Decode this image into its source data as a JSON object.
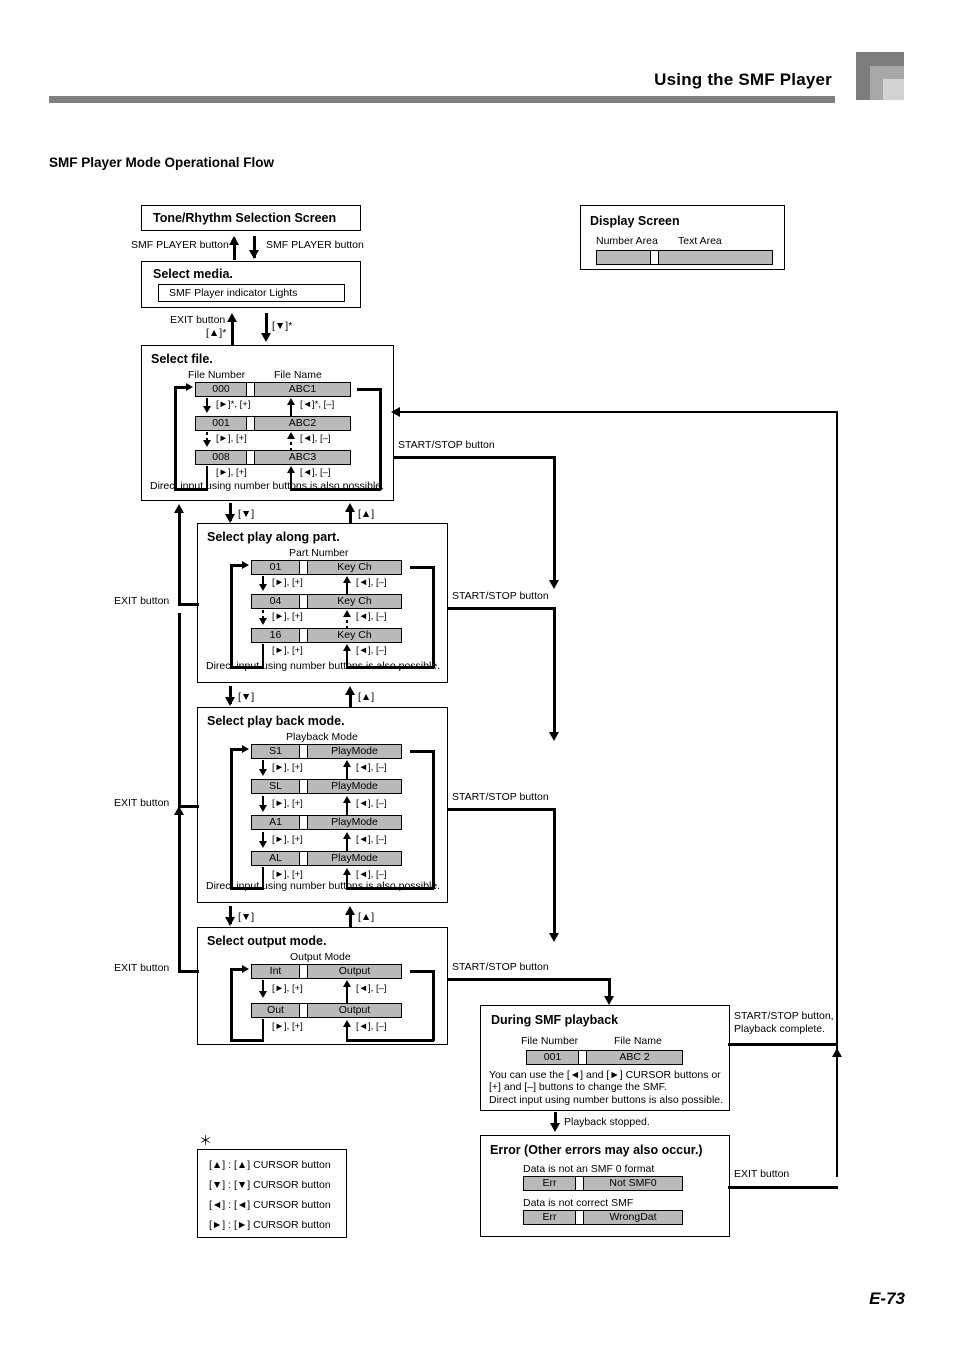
{
  "header": {
    "title": "Using the SMF Player",
    "section_title": "SMF Player Mode Operational Flow",
    "page_number": "E-73"
  },
  "display_screen": {
    "title": "Display Screen",
    "number_area_label": "Number Area",
    "text_area_label": "Text Area"
  },
  "nodes": {
    "tone_rhythm": {
      "title": "Tone/Rhythm Selection Screen"
    },
    "select_media": {
      "title": "Select media.",
      "indicator": "SMF Player indicator Lights"
    },
    "select_file": {
      "title": "Select file.",
      "col1_label": "File Number",
      "col2_label": "File Name",
      "note": "Direct input using number buttons is also possible.",
      "rows": [
        {
          "num": "000",
          "name": "ABC1"
        },
        {
          "num": "001",
          "name": "ABC2"
        },
        {
          "num": "008",
          "name": "ABC3"
        }
      ]
    },
    "select_part": {
      "title": "Select play along part.",
      "col_label": "Part Number",
      "note": "Direct input using number buttons is also possible.",
      "rows": [
        {
          "num": "01",
          "name": "Key  Ch"
        },
        {
          "num": "04",
          "name": "Key  Ch"
        },
        {
          "num": "16",
          "name": "Key  Ch"
        }
      ]
    },
    "select_playback": {
      "title": "Select play back mode.",
      "col_label": "Playback Mode",
      "note": "Direct input using number buttons is also possible.",
      "rows": [
        {
          "num": "S1",
          "name": "PlayMode"
        },
        {
          "num": "SL",
          "name": "PlayMode"
        },
        {
          "num": "A1",
          "name": "PlayMode"
        },
        {
          "num": "AL",
          "name": "PlayMode"
        }
      ]
    },
    "select_output": {
      "title": "Select output mode.",
      "col_label": "Output Mode",
      "rows": [
        {
          "num": "Int",
          "name": "Output"
        },
        {
          "num": "Out",
          "name": "Output"
        }
      ]
    },
    "during_playback": {
      "title": "During SMF playback",
      "col1_label": "File Number",
      "col2_label": "File Name",
      "row": {
        "num": "001",
        "name": "ABC 2"
      },
      "note1": "You can use the [◄] and [►] CURSOR buttons or",
      "note2": "[+] and [–] buttons to change the SMF.",
      "note3": "Direct input using number buttons is also possible."
    },
    "error": {
      "title": "Error (Other errors may also occur.)",
      "case1_label": "Data is not an SMF 0 format",
      "case1": {
        "num": "Err",
        "name": "Not  SMF0"
      },
      "case2_label": "Data is not correct SMF",
      "case2": {
        "num": "Err",
        "name": "WrongDat"
      }
    }
  },
  "transitions": {
    "smf_player_button_up": "SMF PLAYER button",
    "smf_player_button_down": "SMF PLAYER button",
    "exit_button": "EXIT button",
    "exit_button_2": "EXIT button",
    "exit_button_3": "EXIT button",
    "exit_button_4": "EXIT button",
    "exit_button_5": "EXIT button",
    "up_star": "[▲]*",
    "down_star": "[▼]*",
    "down_1": "[▼]",
    "up_1": "[▲]",
    "down_2": "[▼]",
    "up_2": "[▲]",
    "down_3": "[▼]",
    "up_3": "[▲]",
    "start_stop_1": "START/STOP button",
    "start_stop_2": "START/STOP button",
    "start_stop_3": "START/STOP button",
    "start_stop_4": "START/STOP button",
    "start_stop_complete_1": "START/STOP button,",
    "start_stop_complete_2": "Playback complete.",
    "playback_stopped": "Playback stopped."
  },
  "step_labels": {
    "fwd_star": "[►]*, [+]",
    "back_star": "[◄]*, [–]",
    "fwd": "[►], [+]",
    "back": "[◄], [–]"
  },
  "legend": {
    "asterisk": "＊",
    "rows": [
      "[▲] :  [▲] CURSOR button",
      "[▼] :  [▼] CURSOR button",
      "[◄] :  [◄] CURSOR button",
      "[►] :  [►] CURSOR button"
    ]
  }
}
